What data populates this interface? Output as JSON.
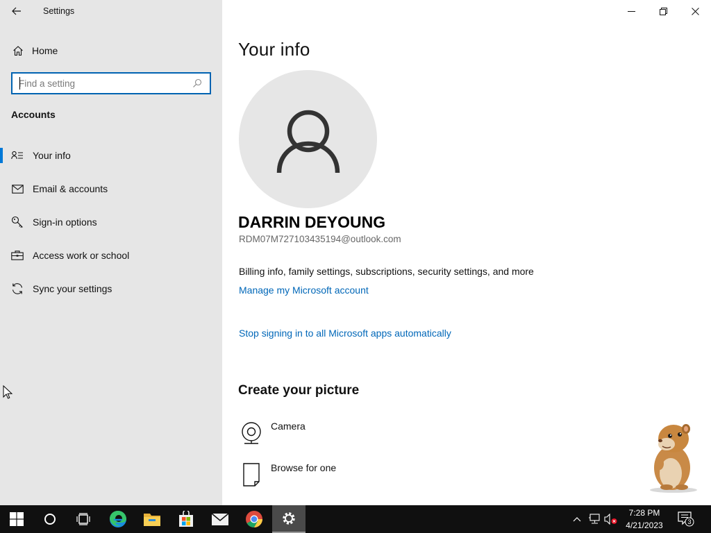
{
  "window": {
    "title": "Settings",
    "controls": [
      "minimize",
      "restore",
      "close"
    ]
  },
  "sidebar": {
    "home_label": "Home",
    "search_placeholder": "Find a setting",
    "section_heading": "Accounts",
    "items": [
      {
        "label": "Your info",
        "icon": "your-info-icon",
        "selected": true
      },
      {
        "label": "Email & accounts",
        "icon": "email-icon",
        "selected": false
      },
      {
        "label": "Sign-in options",
        "icon": "key-icon",
        "selected": false
      },
      {
        "label": "Access work or school",
        "icon": "briefcase-icon",
        "selected": false
      },
      {
        "label": "Sync your settings",
        "icon": "sync-icon",
        "selected": false
      }
    ]
  },
  "main": {
    "page_title": "Your info",
    "user_name": "DARRIN DEYOUNG",
    "user_email": "RDM07M727103435194@outlook.com",
    "billing_text": "Billing info, family settings, subscriptions, security settings, and more",
    "manage_link": "Manage my Microsoft account",
    "stop_link": "Stop signing in to all Microsoft apps automatically",
    "create_picture_title": "Create your picture",
    "picture_options": [
      {
        "label": "Camera",
        "icon": "camera-icon"
      },
      {
        "label": "Browse for one",
        "icon": "browse-icon"
      }
    ]
  },
  "taskbar": {
    "apps": [
      "start-icon",
      "cortana-icon",
      "task-view-icon",
      "edge-icon",
      "file-explorer-icon",
      "store-icon",
      "mail-icon",
      "chrome-icon",
      "settings-icon"
    ],
    "active_app": "settings-icon",
    "clock_time": "7:28 PM",
    "clock_date": "4/21/2023",
    "notification_count": "3"
  },
  "colors": {
    "accent": "#0078d7",
    "link": "#0067b8",
    "sidebar_bg": "#e6e6e6",
    "taskbar_bg": "#101010"
  }
}
